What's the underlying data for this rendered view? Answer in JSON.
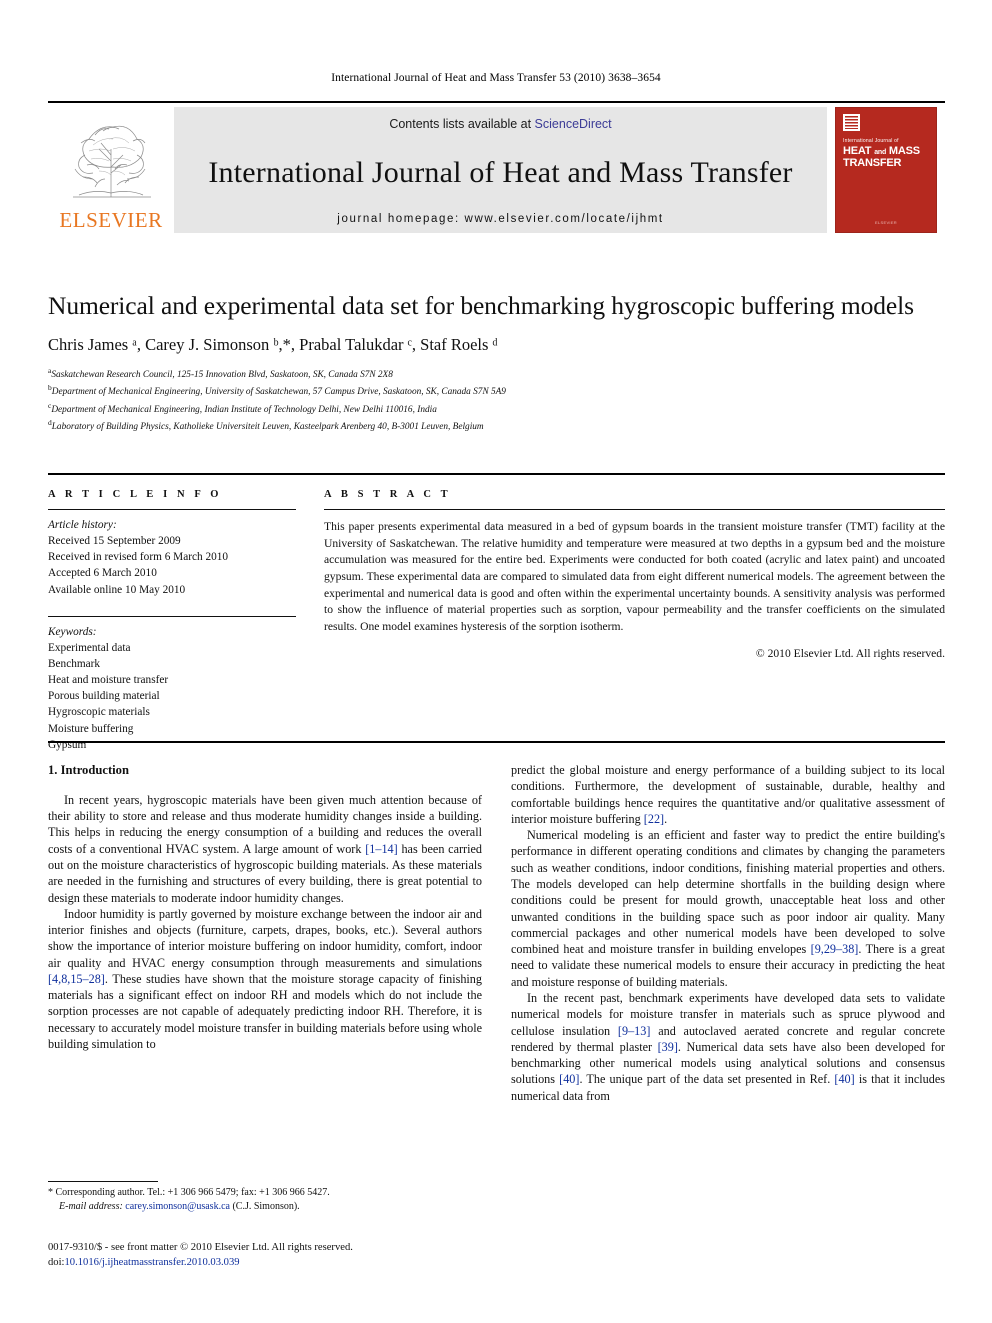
{
  "running_head": "International Journal of Heat and Mass Transfer 53 (2010) 3638–3654",
  "masthead": {
    "publisher_wordmark": "ELSEVIER",
    "contents_prefix": "Contents lists available at ",
    "sciencedirect": "ScienceDirect",
    "journal_title": "International Journal of Heat and Mass Transfer",
    "homepage": "journal homepage: www.elsevier.com/locate/ijhmt",
    "cover": {
      "superior_line": "International Journal of",
      "title_line1_a": "HEAT",
      "title_line1_small": "and",
      "title_line1_b": "MASS",
      "title_line2": "TRANSFER",
      "footer": "ELSEVIER"
    },
    "accent_red": "#b5291f",
    "accent_orange": "#e87722",
    "link_blue": "#3b3b96",
    "banner_gray": "#e6e6e6"
  },
  "article": {
    "title": "Numerical and experimental data set for benchmarking hygroscopic buffering models",
    "authors": "Chris James ᵃ, Carey J. Simonson ᵇ,*, Prabal Talukdar ᶜ, Staf Roels ᵈ",
    "affiliations": [
      "Saskatchewan Research Council, 125-15 Innovation Blvd, Saskatoon, SK, Canada S7N 2X8",
      "Department of Mechanical Engineering, University of Saskatchewan, 57 Campus Drive, Saskatoon, SK, Canada S7N 5A9",
      "Department of Mechanical Engineering, Indian Institute of Technology Delhi, New Delhi 110016, India",
      "Laboratory of Building Physics, Katholieke Universiteit Leuven, Kasteelpark Arenberg 40, B-3001 Leuven, Belgium"
    ],
    "affiliation_marks": [
      "a",
      "b",
      "c",
      "d"
    ]
  },
  "article_info": {
    "heading": "A R T I C L E  I N F O",
    "history_label": "Article history:",
    "history": [
      "Received 15 September 2009",
      "Received in revised form 6 March 2010",
      "Accepted 6 March 2010",
      "Available online 10 May 2010"
    ],
    "keywords_label": "Keywords:",
    "keywords": [
      "Experimental data",
      "Benchmark",
      "Heat and moisture transfer",
      "Porous building material",
      "Hygroscopic materials",
      "Moisture buffering",
      "Gypsum"
    ]
  },
  "abstract": {
    "heading": "A B S T R A C T",
    "text": "This paper presents experimental data measured in a bed of gypsum boards in the transient moisture transfer (TMT) facility at the University of Saskatchewan. The relative humidity and temperature were measured at two depths in a gypsum bed and the moisture accumulation was measured for the entire bed. Experiments were conducted for both coated (acrylic and latex paint) and uncoated gypsum. These experimental data are compared to simulated data from eight different numerical models. The agreement between the experimental and numerical data is good and often within the experimental uncertainty bounds. A sensitivity analysis was performed to show the influence of material properties such as sorption, vapour permeability and the transfer coefficients on the simulated results. One model examines hysteresis of the sorption isotherm.",
    "copyright": "© 2010 Elsevier Ltd. All rights reserved."
  },
  "body": {
    "section_heading": "1. Introduction",
    "left": {
      "p1_a": "In recent years, hygroscopic materials have been given much attention because of their ability to store and release and thus moderate humidity changes inside a building. This helps in reducing the energy consumption of a building and reduces the overall costs of a conventional HVAC system. A large amount of work ",
      "p1_ref": "[1–14]",
      "p1_b": " has been carried out on the moisture characteristics of hygroscopic building materials. As these materials are needed in the furnishing and structures of every building, there is great potential to design these materials to moderate indoor humidity changes.",
      "p2_a": "Indoor humidity is partly governed by moisture exchange between the indoor air and interior finishes and objects (furniture, carpets, drapes, books, etc.). Several authors show the importance of interior moisture buffering on indoor humidity, comfort, indoor air quality and HVAC energy consumption through measurements and simulations ",
      "p2_ref": "[4,8,15–28]",
      "p2_b": ". These studies have shown that the moisture storage capacity of finishing materials has a significant effect on indoor RH and models which do not include the sorption processes are not capable of adequately predicting indoor RH. Therefore, it is necessary to accurately model moisture transfer in building materials before using whole building simulation to"
    },
    "right": {
      "p1_a": "predict the global moisture and energy performance of a building subject to its local conditions. Furthermore, the development of sustainable, durable, healthy and comfortable buildings hence requires the quantitative and/or qualitative assessment of interior moisture buffering ",
      "p1_ref": "[22]",
      "p1_b": ".",
      "p2_a": "Numerical modeling is an efficient and faster way to predict the entire building's performance in different operating conditions and climates by changing the parameters such as weather conditions, indoor conditions, finishing material properties and others. The models developed can help determine shortfalls in the building design where conditions could be present for mould growth, unacceptable heat loss and other unwanted conditions in the building space such as poor indoor air quality. Many commercial packages and other numerical models have been developed to solve combined heat and moisture transfer in building envelopes ",
      "p2_ref": "[9,29–38]",
      "p2_b": ". There is a great need to validate these numerical models to ensure their accuracy in predicting the heat and moisture response of building materials.",
      "p3_a": "In the recent past, benchmark experiments have developed data sets to validate numerical models for moisture transfer in materials such as spruce plywood and cellulose insulation ",
      "p3_ref1": "[9–13]",
      "p3_b": " and autoclaved aerated concrete and regular concrete rendered by thermal plaster ",
      "p3_ref2": "[39]",
      "p3_c": ". Numerical data sets have also been developed for benchmarking other numerical models using analytical solutions and consensus solutions ",
      "p3_ref3": "[40]",
      "p3_d": ". The unique part of the data set presented in Ref. ",
      "p3_ref4": "[40]",
      "p3_e": " is that it includes numerical data from"
    }
  },
  "footnotes": {
    "corresponding": "* Corresponding author. Tel.: +1 306 966 5479; fax: +1 306 966 5427.",
    "email_label": "E-mail address:",
    "email": "carey.simonson@usask.ca",
    "email_suffix": " (C.J. Simonson)."
  },
  "footer": {
    "issn_line": "0017-9310/$ - see front matter © 2010 Elsevier Ltd. All rights reserved.",
    "doi_label": "doi:",
    "doi": "10.1016/j.ijheatmasstransfer.2010.03.039"
  }
}
